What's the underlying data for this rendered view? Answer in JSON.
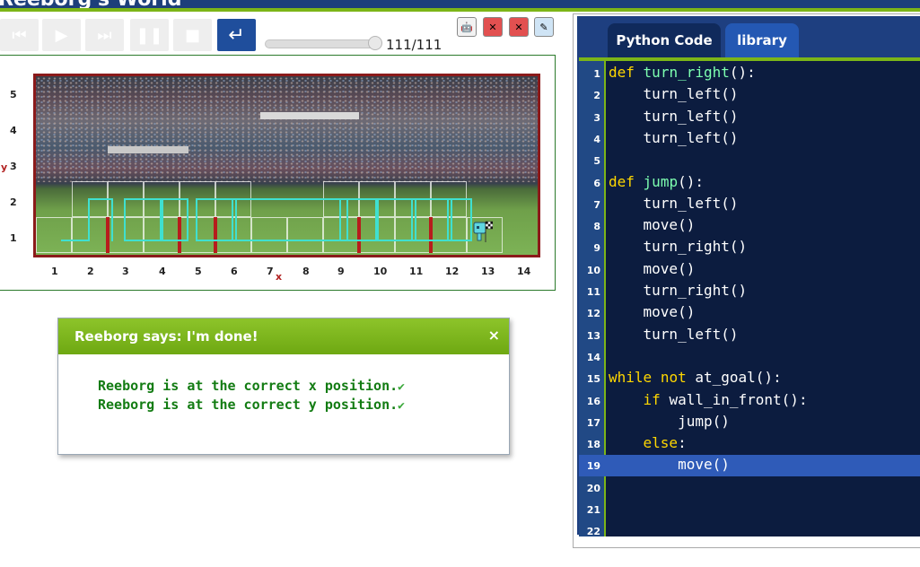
{
  "app": {
    "title": "Reeborg's World"
  },
  "controls": {
    "step_counter": "111/111",
    "slider_progress": 1.0
  },
  "world": {
    "y_label": "y",
    "x_label": "x",
    "y_ticks": [
      "5",
      "4",
      "3",
      "2",
      "1"
    ],
    "x_ticks": [
      "1",
      "2",
      "3",
      "4",
      "5",
      "6",
      "7",
      "8",
      "9",
      "10",
      "11",
      "12",
      "13",
      "14"
    ]
  },
  "dialog": {
    "title": "Reeborg says: I'm done!",
    "close": "×",
    "lines": [
      "Reeborg is at the correct x position.",
      "Reeborg is at the correct y position."
    ],
    "check": "✔"
  },
  "editor": {
    "tabs": [
      "Python Code",
      "library"
    ],
    "highlighted_line": 19,
    "lines": [
      "def turn_right():",
      "    turn_left()",
      "    turn_left()",
      "    turn_left()",
      "",
      "def jump():",
      "    turn_left()",
      "    move()",
      "    turn_right()",
      "    move()",
      "    turn_right()",
      "    move()",
      "    turn_left()",
      "",
      "while not at_goal():",
      "    if wall_in_front():",
      "        jump()",
      "    else:",
      "        move()",
      "",
      "",
      ""
    ],
    "line_numbers": [
      "1",
      "2",
      "3",
      "4",
      "5",
      "6",
      "7",
      "8",
      "9",
      "10",
      "11",
      "12",
      "13",
      "14",
      "15",
      "16",
      "17",
      "18",
      "19",
      "20",
      "21",
      "22"
    ]
  },
  "colors": {
    "accent_blue": "#1e3f80",
    "accent_green": "#7cb518",
    "wall_red": "#b71c1c",
    "path_cyan": "#3fe0d0"
  }
}
